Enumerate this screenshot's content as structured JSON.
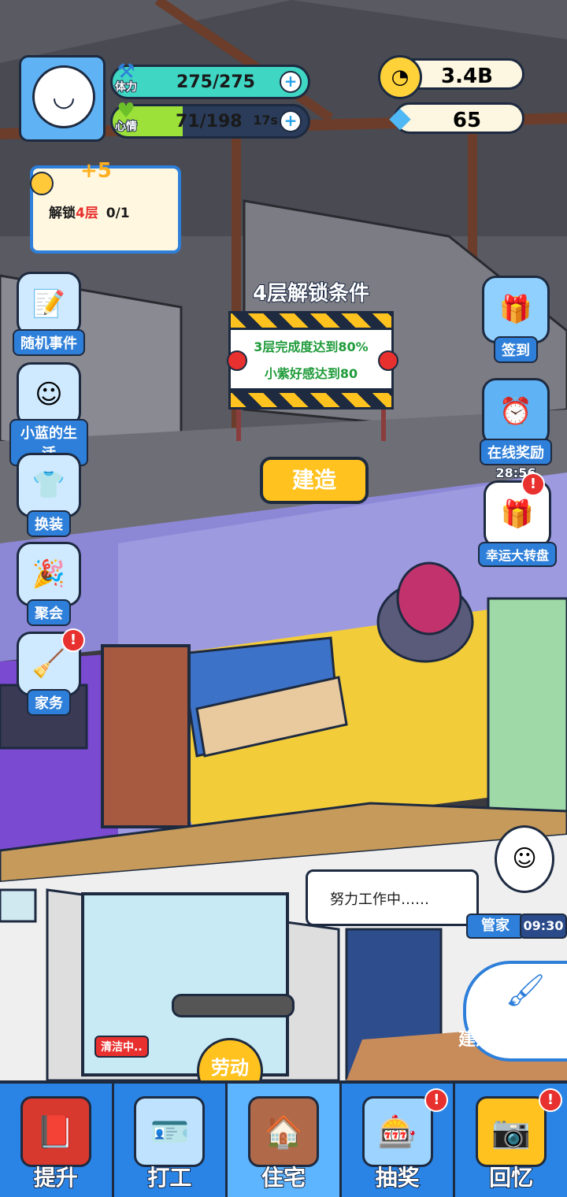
{
  "hud": {
    "stamina_label": "体力",
    "stamina_value": "275/275",
    "stamina_fill": 1.0,
    "mood_label": "心情",
    "mood_value": "71/198",
    "mood_timer": "17s",
    "mood_fill": 0.36,
    "coins": "3.4B",
    "diamonds": "65"
  },
  "quest": {
    "reward": "+5",
    "text_prefix": "解锁",
    "text_highlight": "4层",
    "progress": "0/1"
  },
  "left_menu": [
    {
      "label": "随机事件",
      "icon": "notebook-icon",
      "glyph": "📝"
    },
    {
      "label": "小蓝的生活",
      "icon": "face-icon",
      "glyph": "☺"
    },
    {
      "label": "换装",
      "icon": "shirt-icon",
      "glyph": "👕"
    },
    {
      "label": "聚会",
      "icon": "party-popper-icon",
      "glyph": "🎉"
    },
    {
      "label": "家务",
      "icon": "vacuum-icon",
      "glyph": "🧹"
    }
  ],
  "right_menu": {
    "signin": "签到",
    "online_reward": "在线奖励",
    "online_timer": "28:56",
    "lucky_wheel": "幸运大转盘"
  },
  "unlock_sign": {
    "title": "4层解锁条件",
    "line1": "3层完成度达到80%",
    "line2": "小紫好感达到80",
    "build_button": "建造"
  },
  "butler": {
    "speech": "努力工作中……",
    "label": "管家",
    "timer": "09:30"
  },
  "build_mode": "建造模式",
  "cleaning": {
    "tag": "清洁中..",
    "labor_button": "劳动"
  },
  "nav": [
    {
      "label": "提升",
      "icon": "book-icon",
      "glyph": "📕",
      "badge": false,
      "active": false
    },
    {
      "label": "打工",
      "icon": "id-card-icon",
      "glyph": "🪪",
      "badge": false,
      "active": false
    },
    {
      "label": "住宅",
      "icon": "house-icon",
      "glyph": "🏠",
      "badge": false,
      "active": true
    },
    {
      "label": "抽奖",
      "icon": "gacha-machine-icon",
      "glyph": "🎰",
      "badge": true,
      "active": false
    },
    {
      "label": "回忆",
      "icon": "camera-icon",
      "glyph": "📷",
      "badge": true,
      "active": false
    }
  ],
  "colors": {
    "stamina": "#3fd6c4",
    "mood": "#9be13a",
    "accent_blue": "#2e7fd9",
    "alert_red": "#e8302e",
    "build_yellow": "#ffc21f"
  }
}
